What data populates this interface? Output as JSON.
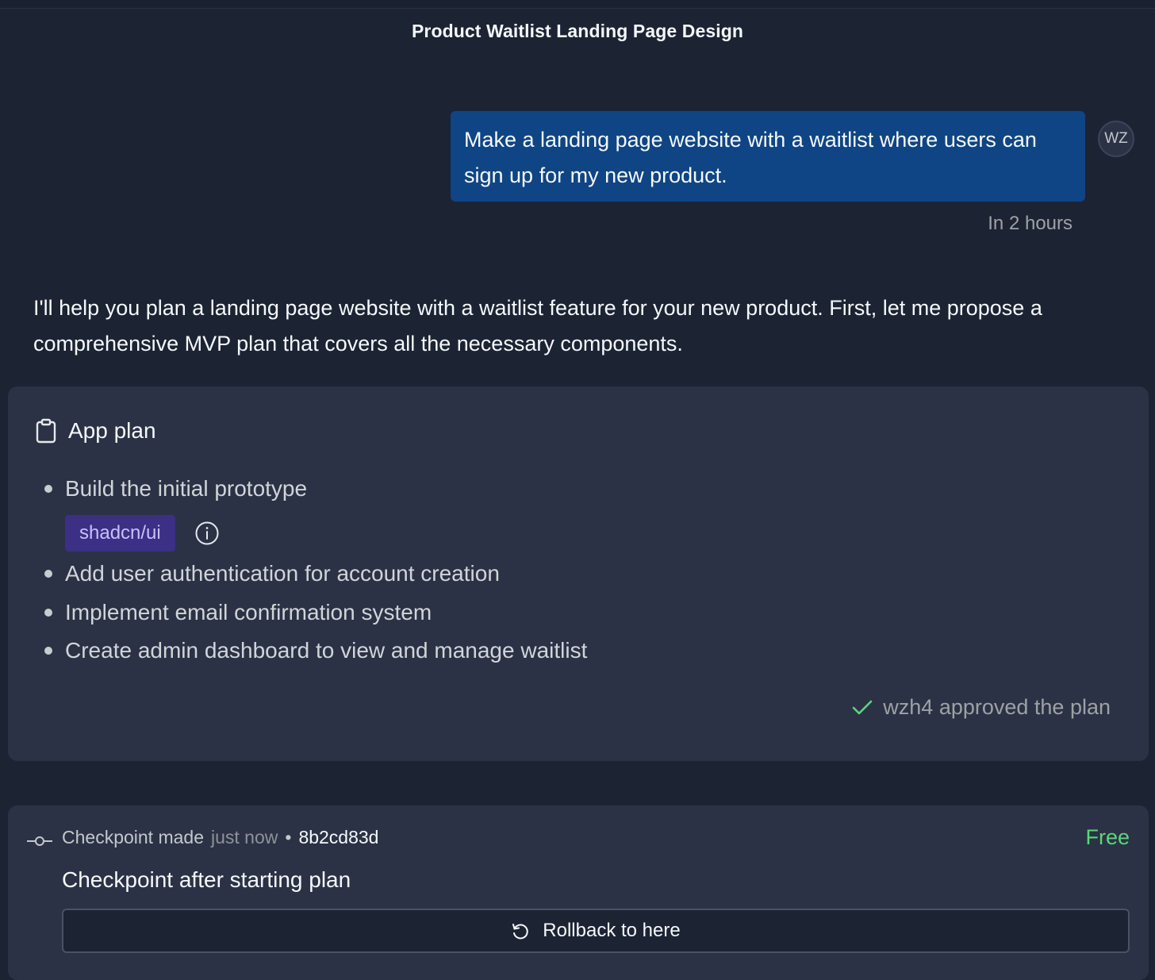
{
  "header": {
    "title": "Product Waitlist Landing Page Design"
  },
  "user_message": {
    "text": "Make a landing page website with a waitlist where users can sign up for my new product.",
    "avatar_initials": "WZ",
    "timestamp": "In 2 hours"
  },
  "assistant_message": {
    "text": "I'll help you plan a landing page website with a waitlist feature for your new product. First, let me propose a comprehensive MVP plan that covers all the necessary components."
  },
  "plan": {
    "title": "App plan",
    "icon": "clipboard-icon",
    "first_item": "Build the initial prototype",
    "tag": "shadcn/ui",
    "items": [
      "Add user authentication for account creation",
      "Implement email confirmation system",
      "Create admin dashboard to view and manage waitlist"
    ],
    "approval": "wzh4 approved the plan",
    "approval_color": "#5bd67a"
  },
  "checkpoint": {
    "made_label": "Checkpoint made",
    "time": "just now",
    "separator": "•",
    "hash": "8b2cd83d",
    "cost": "Free",
    "cost_color": "#5bd67a",
    "title": "Checkpoint after starting plan",
    "rollback_label": "Rollback to here"
  },
  "colors": {
    "background": "#1c2333",
    "card": "#2b3245",
    "user_bubble": "#0f4584",
    "tag_bg": "#3b2f86"
  }
}
